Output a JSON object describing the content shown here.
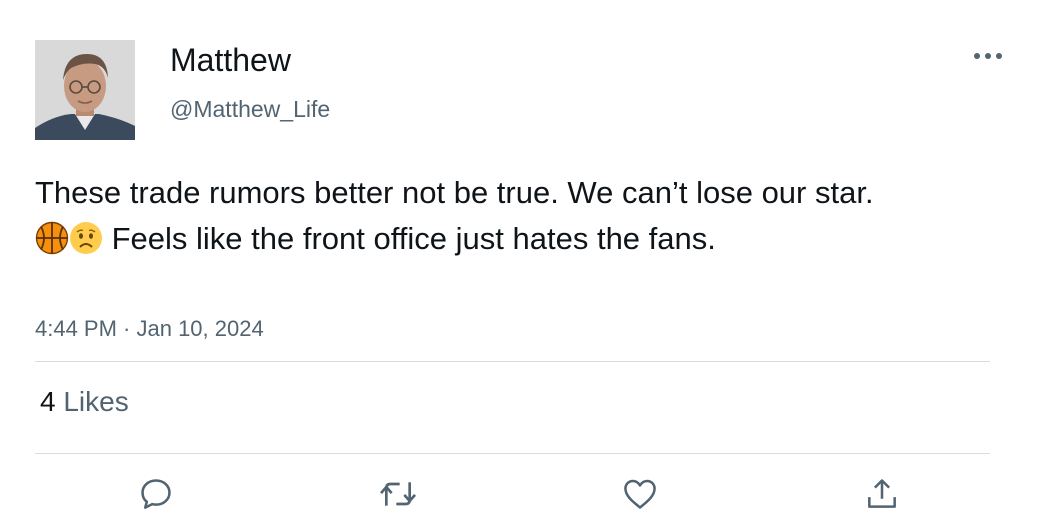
{
  "author": {
    "name": "Matthew",
    "handle": "@Matthew_Life",
    "avatar_icon": "profile-photo"
  },
  "tweet": {
    "text_part1": "These trade rumors better not be true. We can’t lose our star. ",
    "emojis": [
      "basketball-emoji",
      "worried-face-emoji"
    ],
    "text_part2": " Feels like the front office just hates the fans.",
    "timestamp": "4:44 PM · Jan 10, 2024"
  },
  "stats": {
    "likes_count": "4",
    "likes_label": "Likes"
  },
  "actions": [
    "reply-icon",
    "retweet-icon",
    "like-icon",
    "share-icon"
  ],
  "colors": {
    "text_primary": "#0f1419",
    "text_secondary": "#536471",
    "divider": "#d9dcdf",
    "icon": "#536471"
  }
}
